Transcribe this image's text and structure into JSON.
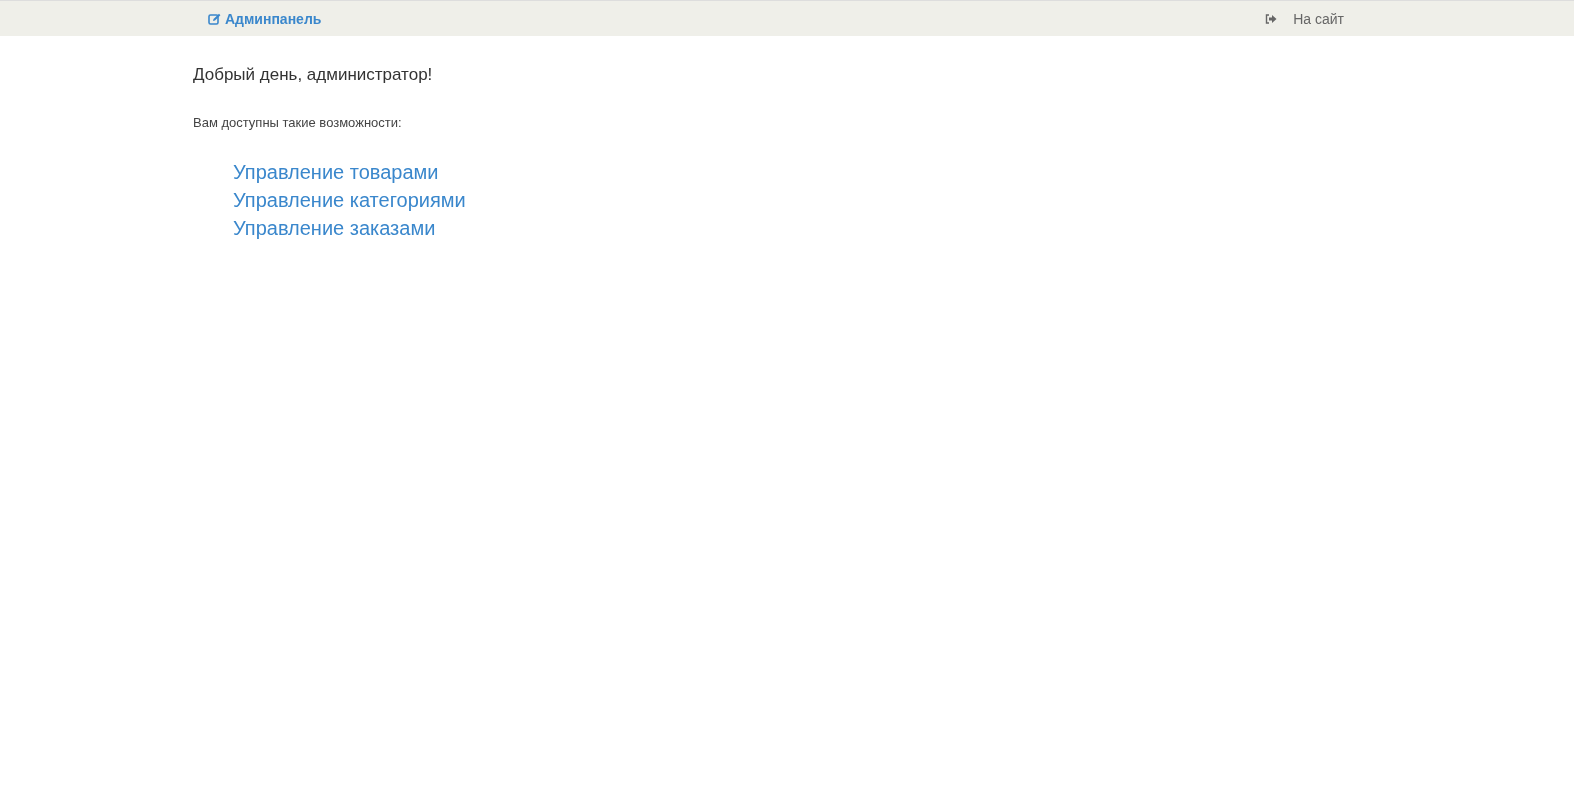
{
  "topbar": {
    "brand": "Админпанель",
    "site_link": "На сайт"
  },
  "greeting": "Добрый день, администратор!",
  "intro": "Вам доступны такие возможности:",
  "links": [
    "Управление товарами",
    "Управление категориями",
    "Управление заказами"
  ]
}
